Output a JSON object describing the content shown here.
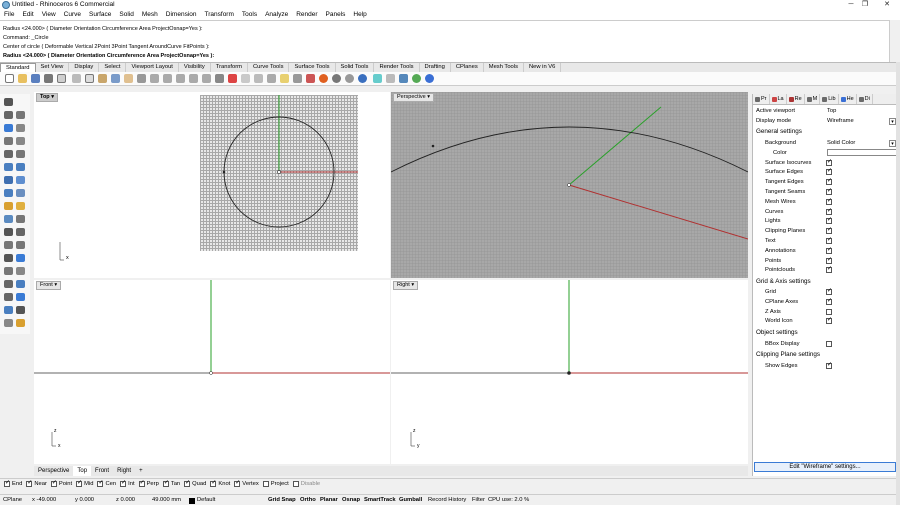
{
  "window": {
    "title": "Untitled - Rhinoceros 6 Commercial"
  },
  "menu": [
    "File",
    "Edit",
    "View",
    "Curve",
    "Surface",
    "Solid",
    "Mesh",
    "Dimension",
    "Transform",
    "Tools",
    "Analyze",
    "Render",
    "Panels",
    "Help"
  ],
  "command_history": [
    "Radius <24.000> ( Diameter  Orientation  Circumference  Area  ProjectOsnap=Yes ):",
    "Command: _Circle",
    "Center of circle ( Deformable  Vertical  2Point  3Point  Tangent  AroundCurve  FitPoints ):",
    "Radius <24.000> ( Diameter  Orientation  Circumference  Area  ProjectOsnap=Yes ):"
  ],
  "toolbar_tabs": [
    "Standard",
    "Set View",
    "Display",
    "Select",
    "Viewport Layout",
    "Visibility",
    "Transform",
    "Curve Tools",
    "Surface Tools",
    "Solid Tools",
    "Render Tools",
    "Drafting",
    "CPlanes",
    "Mesh Tools",
    "New in V6"
  ],
  "viewports": {
    "top": "Top",
    "perspective": "Perspective",
    "front": "Front",
    "right": "Right"
  },
  "axis": {
    "x": "x",
    "y": "y",
    "z": "z"
  },
  "viewport_tabs": [
    "Perspective",
    "Top",
    "Front",
    "Right"
  ],
  "viewport_tab_add": "+",
  "osnaps": [
    {
      "label": "End",
      "on": true
    },
    {
      "label": "Near",
      "on": true
    },
    {
      "label": "Point",
      "on": true
    },
    {
      "label": "Mid",
      "on": true
    },
    {
      "label": "Cen",
      "on": true
    },
    {
      "label": "Int",
      "on": true
    },
    {
      "label": "Perp",
      "on": true
    },
    {
      "label": "Tan",
      "on": true
    },
    {
      "label": "Quad",
      "on": true
    },
    {
      "label": "Knot",
      "on": true
    },
    {
      "label": "Vertex",
      "on": true
    },
    {
      "label": "Project",
      "on": false
    },
    {
      "label": "Disable",
      "on": false
    }
  ],
  "status": {
    "cplane": "CPlane",
    "x": "x -49.000",
    "y": "y 0.000",
    "z": "z 0.000",
    "dist": "49.000 mm",
    "layer": "Default",
    "items": [
      "Grid Snap",
      "Ortho",
      "Planar",
      "Osnap",
      "SmartTrack",
      "Gumball",
      "Record History",
      "Filter",
      "CPU use: 2.0 %"
    ]
  },
  "panel": {
    "tabs": [
      "Pr",
      "La",
      "Re",
      "M",
      "Lib",
      "He",
      "Di"
    ],
    "active_viewport_label": "Active viewport",
    "active_viewport_value": "Top",
    "display_mode_label": "Display mode",
    "display_mode_value": "Wireframe",
    "general_settings": "General settings",
    "background_label": "Background",
    "background_value": "Solid Color",
    "color_label": "Color",
    "general_checks": [
      {
        "label": "Surface Isocurves",
        "on": true
      },
      {
        "label": "Surface Edges",
        "on": true
      },
      {
        "label": "Tangent Edges",
        "on": true
      },
      {
        "label": "Tangent Seams",
        "on": true
      },
      {
        "label": "Mesh Wires",
        "on": true
      },
      {
        "label": "Curves",
        "on": true
      },
      {
        "label": "Lights",
        "on": true
      },
      {
        "label": "Clipping Planes",
        "on": true
      },
      {
        "label": "Text",
        "on": true
      },
      {
        "label": "Annotations",
        "on": true
      },
      {
        "label": "Points",
        "on": true
      },
      {
        "label": "Pointclouds",
        "on": true
      }
    ],
    "grid_axis_settings": "Grid & Axis settings",
    "grid_checks": [
      {
        "label": "Grid",
        "on": true
      },
      {
        "label": "CPlane Axes",
        "on": true
      },
      {
        "label": "Z Axis",
        "on": false
      },
      {
        "label": "World Icon",
        "on": true
      }
    ],
    "object_settings": "Object settings",
    "bbox_label": "BBox Display",
    "bbox_on": false,
    "clipping_settings": "Clipping Plane settings",
    "show_edges_label": "Show Edges",
    "show_edges_on": true,
    "edit_button": "Edit \"Wireframe\" settings..."
  },
  "colors": {
    "x_axis": "#b03030",
    "y_axis": "#2aa02a",
    "curve": "#222222"
  }
}
